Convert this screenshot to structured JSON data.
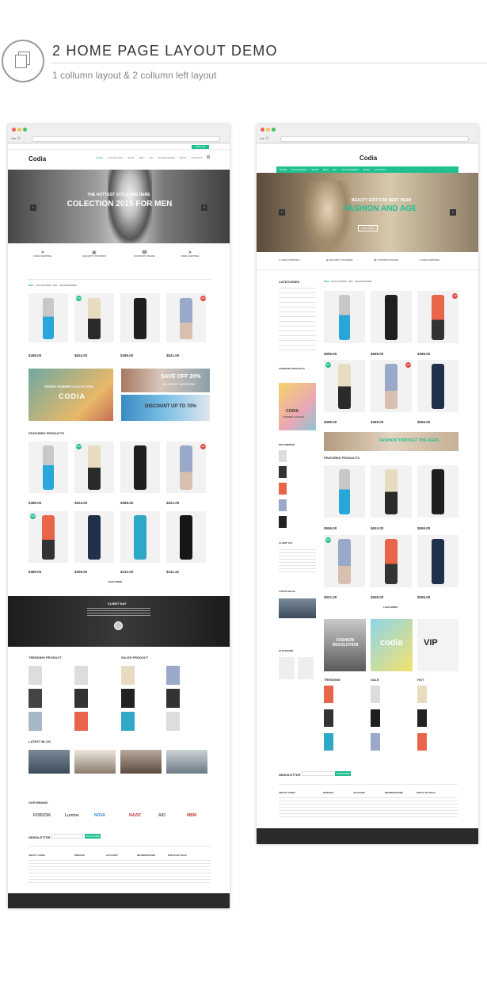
{
  "header": {
    "title": "2 HOME PAGE LAYOUT DEMO",
    "subtitle": "1 collumn layout & 2 collumn left layout"
  },
  "left": {
    "logo": "Codia",
    "nav": [
      "HOME",
      "COLLECTION",
      "SHOP",
      "MEN",
      "KID",
      "ACCESSORIES",
      "BLOG",
      "CONTACT"
    ],
    "hero_small": "THE HOTTEST STYLE ARE HERE",
    "hero_big": "COLECTION 2015 FOR MEN",
    "features": [
      "FREE SHIPPING",
      "SECURITY PAYMENT",
      "SUPPORT ONLINE",
      "FREE SHIPPING"
    ],
    "tabs": [
      "MEN",
      "COLLECTION",
      "KID",
      "ACCESSORIES"
    ],
    "prices1": [
      "$389.00",
      "$624.00",
      "$389.00",
      "$521.00"
    ],
    "banner_a": "SPRING SUMMER COLLECTION",
    "banner_a_logo": "CODIA",
    "banner_b": "SAVE OFF 20%",
    "banner_b2": "ON EVERY WEEKEND",
    "banner_c": "DISCOUNT UP TO 70%",
    "featured": "FEATURED PRODUCTS",
    "prices2": [
      "$389.00",
      "$624.00",
      "$389.00",
      "$521.00"
    ],
    "prices3": [
      "$389.00",
      "$359.00",
      "$312.00",
      "$311.42"
    ],
    "load": "LOAD MORE",
    "client": "CLIENT SAY",
    "trending": "TRENDING PRODUCT",
    "sales": "SALES PRODUCT",
    "blog": "LATEST BLOG",
    "brand": "OUR BRAND",
    "brands": [
      "KORZON",
      "Lumine",
      "NOVA",
      "NAZIC",
      "AIO",
      "MBM"
    ],
    "newsletter": "NEWSLETTER",
    "subscribe": "SUBSCRIBE",
    "footer_cols": [
      "ABOUT CODIA",
      "SERVICE",
      "ACCOUNT",
      "INFORMATIONS",
      "POPULAR TAGS"
    ]
  },
  "right": {
    "logo": "Codia",
    "nav": [
      "HOME",
      "COLLECTION",
      "SHOP",
      "MEN",
      "KID",
      "ACCESSORIES",
      "BLOG",
      "CONTACT"
    ],
    "hero_small": "BEAUTY EDIT FOR NEXT YEAR",
    "hero_big": "FASHION AND AGE",
    "shop": "SHOP NOW",
    "features": [
      "FREE SHIPPING",
      "SECURITY PAYMENT",
      "SUPPORT ONLINE",
      "FREE SHIPPING"
    ],
    "categories": "CATEGORIES",
    "tabs": [
      "MEN",
      "COLLECTION",
      "KID",
      "ACCESSORIES"
    ],
    "prices1": [
      "$599.00",
      "$699.00",
      "$389.00"
    ],
    "prices2": [
      "$389.00",
      "$389.00",
      "$559.00"
    ],
    "compare": "COMPARE PRODUCTS",
    "codia": "CODIA",
    "summer": "SUMMER FASHION",
    "banner": "FASHION THROUGT THE AGES",
    "recommend": "RECOMMEND",
    "featured": "FEATURED PRODUCTS",
    "prices3": [
      "$559.00",
      "$624.00",
      "$559.00"
    ],
    "prices4": [
      "$521.00",
      "$559.00",
      "$555.00"
    ],
    "client": "CLIENT SAY",
    "blog": "LATEST BLOG",
    "brand": "OUR BRAND",
    "load": "LOAD MORE",
    "promo1": "FASHION REVOLUTION",
    "promo2": "codia",
    "promo3": "VIP",
    "cols": [
      "TRENDING",
      "SALE",
      "HOT"
    ],
    "newsletter": "NEWSLETTER",
    "subscribe": "SUBSCRIBE",
    "footer_cols": [
      "ABOUT CODIA",
      "SERVICE",
      "ACCOUNT",
      "INFORMATIONS",
      "POPULAR TAGS"
    ]
  }
}
